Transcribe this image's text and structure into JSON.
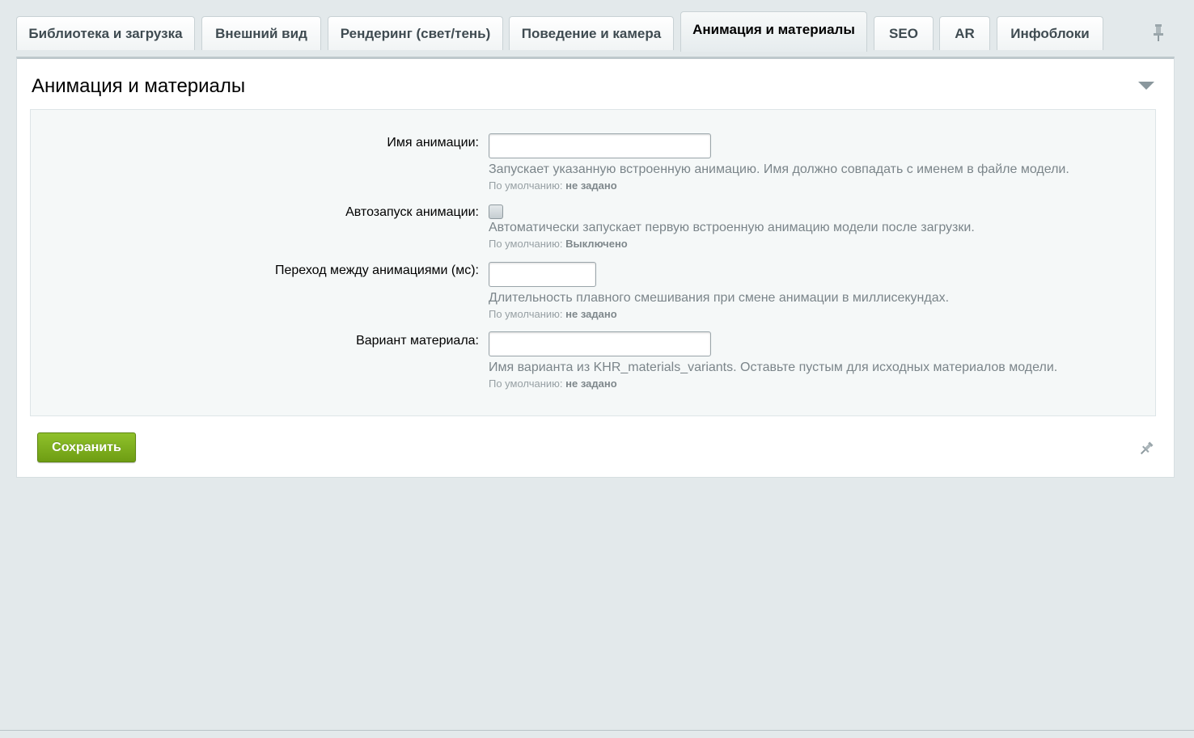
{
  "tabs": [
    {
      "label": "Библиотека и загрузка"
    },
    {
      "label": "Внешний вид"
    },
    {
      "label": "Рендеринг (свет/тень)"
    },
    {
      "label": "Поведение и камера"
    },
    {
      "label": "Анимация и материалы",
      "active": true
    },
    {
      "label": "SEO"
    },
    {
      "label": "AR"
    },
    {
      "label": "Инфоблоки"
    }
  ],
  "panel": {
    "title": "Анимация и материалы"
  },
  "fields": [
    {
      "label": "Имя анимации:",
      "type": "text",
      "value": "",
      "description": "Запускает указанную встроенную анимацию. Имя должно совпадать с именем в файле модели.",
      "default_prefix": "По умолчанию:",
      "default_value": "не задано"
    },
    {
      "label": "Автозапуск анимации:",
      "type": "checkbox",
      "checked": false,
      "description": "Автоматически запускает первую встроенную анимацию модели после загрузки.",
      "default_prefix": "По умолчанию:",
      "default_value": "Выключено"
    },
    {
      "label": "Переход между анимациями (мс):",
      "type": "text",
      "value": "",
      "description": "Длительность плавного смешивания при смене анимации в миллисекундах.",
      "default_prefix": "По умолчанию:",
      "default_value": "не задано"
    },
    {
      "label": "Вариант материала:",
      "type": "text",
      "value": "",
      "description": "Имя варианта из KHR_materials_variants. Оставьте пустым для исходных материалов модели.",
      "default_prefix": "По умолчанию:",
      "default_value": "не задано"
    }
  ],
  "actions": {
    "save_label": "Сохранить"
  },
  "icons": {
    "pin": "pin-icon",
    "collapse": "chevron-down-icon"
  },
  "colors": {
    "save_button": "#7aab1c",
    "background": "#e3e9eb"
  }
}
